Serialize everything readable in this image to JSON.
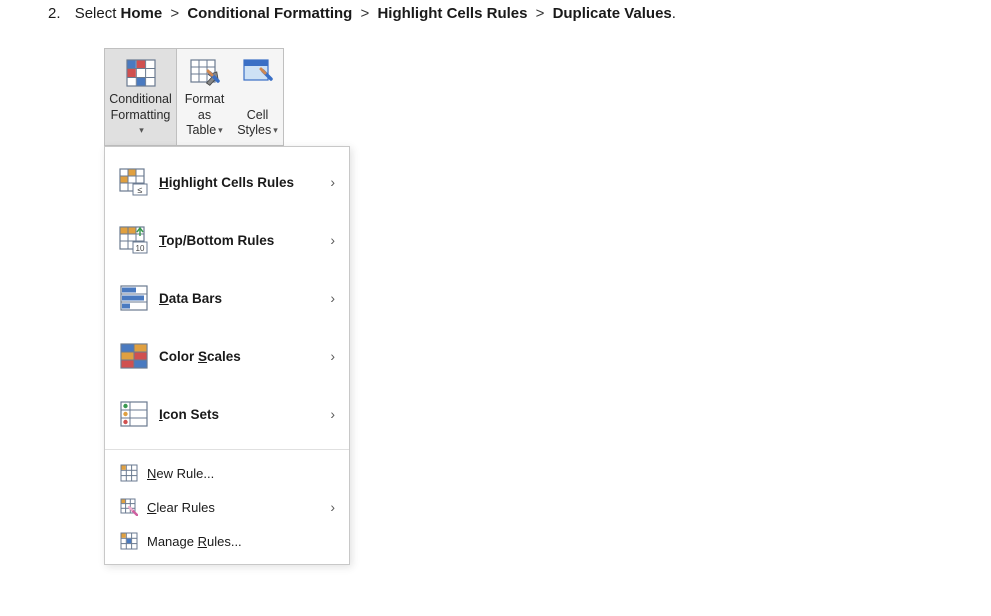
{
  "instruction": {
    "number": "2.",
    "prefix": "Select ",
    "path": [
      "Home",
      "Conditional Formatting",
      "Highlight Cells Rules",
      "Duplicate Values"
    ],
    "separator": ">",
    "suffix": "."
  },
  "ribbon": {
    "conditional_formatting": {
      "line1": "Conditional",
      "line2": "Formatting"
    },
    "format_as_table": {
      "line1": "Format as",
      "line2": "Table"
    },
    "cell_styles": {
      "line1": "Cell",
      "line2": "Styles"
    }
  },
  "menu": {
    "highlight_cells_rules": "Highlight Cells Rules",
    "top_bottom_rules": "Top/Bottom Rules",
    "data_bars": "Data Bars",
    "color_scales": "Color Scales",
    "icon_sets": "Icon Sets",
    "new_rule": "New Rule...",
    "clear_rules": "Clear Rules",
    "manage_rules": "Manage Rules..."
  },
  "chevron": "›"
}
